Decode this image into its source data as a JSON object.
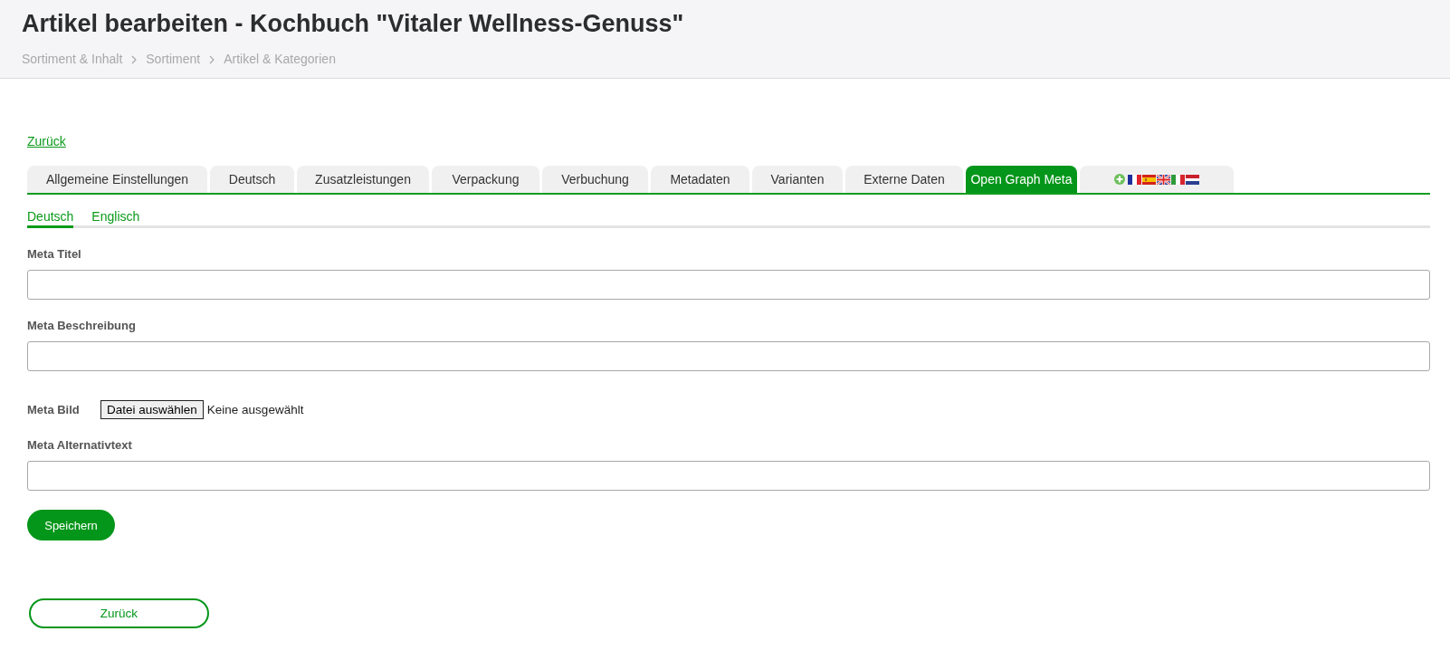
{
  "header": {
    "title": "Artikel bearbeiten - Kochbuch \"Vitaler Wellness-Genuss\"",
    "breadcrumb": [
      "Sortiment & Inhalt",
      "Sortiment",
      "Artikel & Kategorien"
    ]
  },
  "back_link": "Zurück",
  "tabs": [
    {
      "kind": "text",
      "label": "Allgemeine Einstellungen",
      "selected": false
    },
    {
      "kind": "text",
      "label": "Deutsch",
      "selected": false
    },
    {
      "kind": "text",
      "label": "Zusatzleistungen",
      "selected": false
    },
    {
      "kind": "text",
      "label": "Verpackung",
      "selected": false
    },
    {
      "kind": "text",
      "label": "Verbuchung",
      "selected": false
    },
    {
      "kind": "text",
      "label": "Metadaten",
      "selected": false
    },
    {
      "kind": "text",
      "label": "Varianten",
      "selected": false
    },
    {
      "kind": "text",
      "label": "Externe Daten",
      "selected": false
    },
    {
      "kind": "text",
      "label": "Open Graph Meta",
      "selected": true
    },
    {
      "kind": "flags",
      "selected": false
    }
  ],
  "language_tabs": [
    {
      "label": "Deutsch",
      "selected": true
    },
    {
      "label": "Englisch",
      "selected": false
    }
  ],
  "fields": [
    {
      "kind": "text",
      "label": "Meta Titel"
    },
    {
      "kind": "text",
      "label": "Meta Beschreibung"
    },
    {
      "kind": "file",
      "label": "Meta Bild",
      "button": "Datei auswählen",
      "status": "Keine ausgewählt"
    },
    {
      "kind": "text",
      "label": "Meta Alternativtext"
    }
  ],
  "save_button": "Speichern",
  "back_button": "Zurück"
}
